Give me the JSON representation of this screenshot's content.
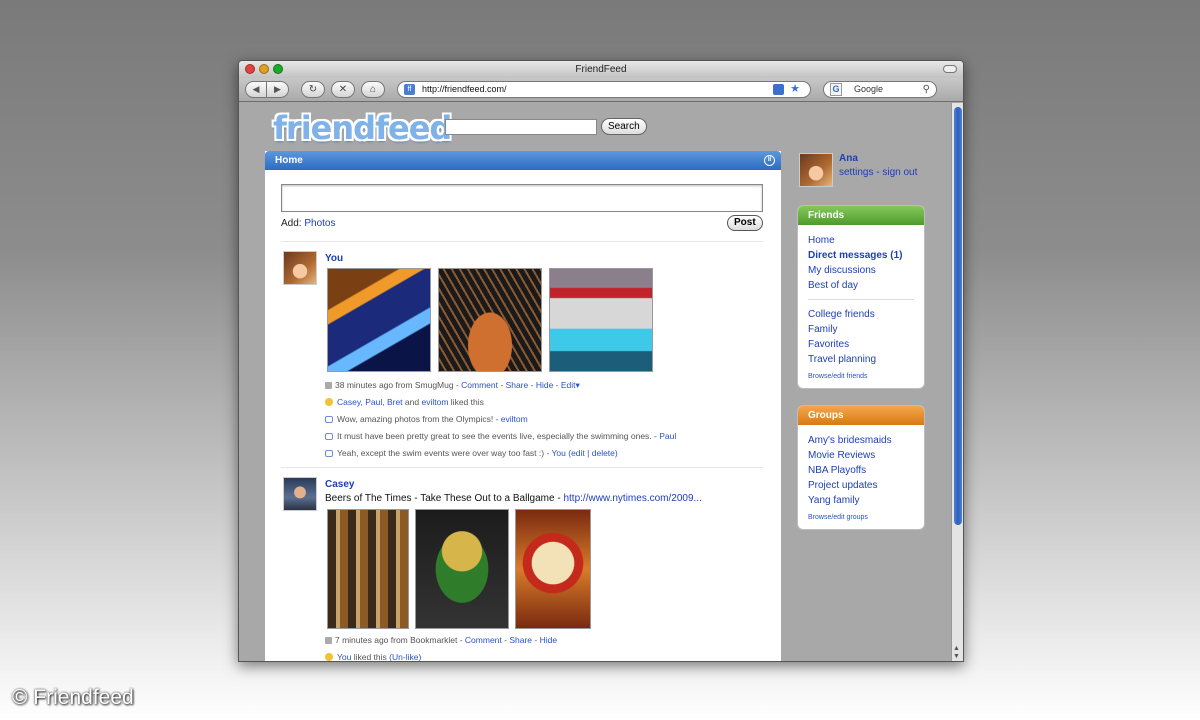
{
  "window": {
    "title": "FriendFeed"
  },
  "toolbar": {
    "url": "http://friendfeed.com/",
    "search_placeholder": "Google",
    "favicon_letter": "ff",
    "search_engine_letter": "G"
  },
  "site": {
    "logo": "friendfeed",
    "search_button": "Search"
  },
  "feed": {
    "header": "Home",
    "add_label": "Add:",
    "add_photos": "Photos",
    "post_button": "Post",
    "entries": [
      {
        "author": "You",
        "meta": {
          "time": "38 minutes ago from SmugMug",
          "actions": [
            "Comment",
            "Share",
            "Hide",
            "Edit▾"
          ]
        },
        "likes": {
          "names": [
            "Casey",
            "Paul",
            "Bret"
          ],
          "and": "and",
          "last": "eviltom",
          "suffix": "liked this"
        },
        "comments": [
          {
            "text": "Wow, amazing photos from the Olympics! -",
            "author": "eviltom"
          },
          {
            "text": "It must have been pretty great to see the events live, especially the swimming ones. -",
            "author": "Paul"
          },
          {
            "text": "Yeah, except the swim events were over way too fast :) -",
            "author": "You",
            "edit": "edit",
            "delete": "delete"
          }
        ]
      },
      {
        "author": "Casey",
        "title": "Beers of The Times - Take These Out to a Ballgame -",
        "title_link": "http://www.nytimes.com/2009...",
        "meta": {
          "time": "7 minutes ago from Bookmarklet",
          "actions": [
            "Comment",
            "Share",
            "Hide"
          ]
        },
        "likes": {
          "you": "You",
          "suffix": "liked this",
          "unlike": "Un-like"
        }
      }
    ]
  },
  "sidebar": {
    "user": {
      "name": "Ana",
      "settings": "settings",
      "sign_out": "sign out"
    },
    "friends": {
      "header": "Friends",
      "items": [
        "Home",
        "Direct messages (1)",
        "My discussions",
        "Best of day"
      ],
      "lists": [
        "College friends",
        "Family",
        "Favorites",
        "Travel planning"
      ],
      "browse": "Browse/edit friends"
    },
    "groups": {
      "header": "Groups",
      "items": [
        "Amy's bridesmaids",
        "Movie Reviews",
        "NBA Playoffs",
        "Project updates",
        "Yang family"
      ],
      "browse": "Browse/edit groups"
    }
  },
  "watermark": "© Friendfeed"
}
